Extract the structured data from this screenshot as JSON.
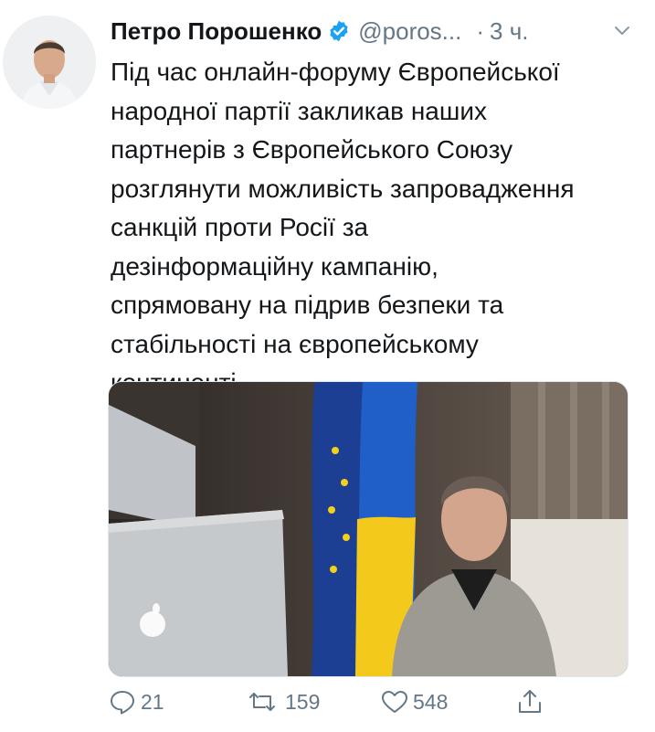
{
  "tweet": {
    "author_name": "Петро Порошенко",
    "handle": "@poros...",
    "separator": "·",
    "time": "3 ч.",
    "text_lines": [
      "Під час онлайн-форуму Європейської",
      "народної партії закликав наших",
      "партнерів з Європейського Союзу",
      "розглянути можливість запровадження",
      "санкцій проти Росії за",
      "дезінформаційну кампанію,",
      "спрямовану на підрив безпеки та",
      "стабільності на європейському",
      "континенті."
    ]
  },
  "actions": {
    "reply_count": "21",
    "retweet_count": "159",
    "like_count": "548"
  },
  "colors": {
    "text": "#14171a",
    "muted": "#657786",
    "verified": "#1da1f2"
  },
  "icons": [
    "verified-badge-icon",
    "chevron-down-icon",
    "reply-icon",
    "retweet-icon",
    "like-icon",
    "share-icon"
  ]
}
